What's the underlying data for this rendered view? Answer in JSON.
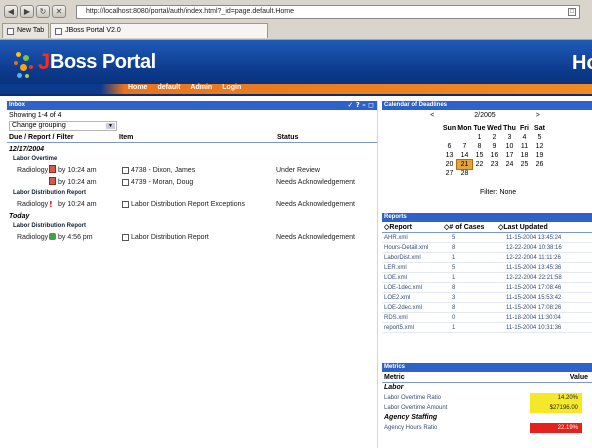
{
  "browser": {
    "url": "http://localhost:8080/portal/auth/index.html?_id=page.default.Home",
    "tabs": [
      {
        "label": "New Tab"
      },
      {
        "label": "JBoss Portal V2.0"
      }
    ]
  },
  "header": {
    "logo_j": "J",
    "logo_text": "Boss Portal",
    "right_text": "Ho",
    "menu": [
      "Home",
      "default",
      "Admin",
      "Login"
    ]
  },
  "inbox": {
    "title": "Inbox",
    "controls": "✓ ? – ◻",
    "showing": "Showing 1-4 of 4",
    "grouping": "Change grouping",
    "columns": [
      "Due / Report / Filter",
      "Item",
      "Status"
    ],
    "groups": [
      {
        "label": "Labor Overtime"
      },
      {
        "label": "Labor Distribution Report"
      },
      {
        "label": "Labor Distribution Report"
      }
    ],
    "dates": [
      "12/17/2004",
      "Today"
    ],
    "rows": [
      {
        "category": "Radiology",
        "due": "by 10:24 am",
        "item": "4738 - Dixon, James",
        "status": "Under Review"
      },
      {
        "category": "",
        "due": "by 10:24 am",
        "item": "4739 - Moran, Doug",
        "status": "Needs Acknowledgement"
      },
      {
        "category": "Radiology",
        "due": "by 10:24 am",
        "item": "Labor Distribution Report Exceptions",
        "status": "Needs Acknowledgement"
      },
      {
        "category": "Radiology",
        "due": "by 4:56 pm",
        "item": "Labor Distribution Report",
        "status": "Needs Acknowledgement"
      }
    ]
  },
  "calendar": {
    "title": "Calendar of Deadlines",
    "prev": "<",
    "month": "2/2005",
    "next": ">",
    "days": [
      "Sun",
      "Mon",
      "Tue",
      "Wed",
      "Thu",
      "Fri",
      "Sat"
    ],
    "weeks": [
      [
        "",
        "",
        "1",
        "2",
        "3",
        "4",
        "5"
      ],
      [
        "6",
        "7",
        "8",
        "9",
        "10",
        "11",
        "12"
      ],
      [
        "13",
        "14",
        "15",
        "16",
        "17",
        "18",
        "19"
      ],
      [
        "20",
        "21",
        "22",
        "23",
        "24",
        "25",
        "26"
      ],
      [
        "27",
        "28",
        "",
        "",
        "",
        "",
        ""
      ]
    ],
    "today": "21",
    "filter": "Filter: None"
  },
  "reports": {
    "title": "Reports",
    "columns": [
      "◇Report",
      "◇# of Cases",
      "◇Last Updated"
    ],
    "rows": [
      {
        "name": "AHR.xml",
        "cases": "5",
        "updated": "11-15-2004 13:45:24"
      },
      {
        "name": "Hours-Detail.xml",
        "cases": "8",
        "updated": "12-22-2004 10:38:16"
      },
      {
        "name": "LaborDist.xml",
        "cases": "1",
        "updated": "12-22-2004 11:11:26"
      },
      {
        "name": "LER.xml",
        "cases": "5",
        "updated": "11-15-2004 13:45:36"
      },
      {
        "name": "LOE.xml",
        "cases": "1",
        "updated": "12-22-2004 22:21:58"
      },
      {
        "name": "LOE-1dec.xml",
        "cases": "8",
        "updated": "11-15-2004 17:08:46"
      },
      {
        "name": "LOE2.xml",
        "cases": "3",
        "updated": "11-15-2004 15:53:42"
      },
      {
        "name": "LOE-2dec.xml",
        "cases": "8",
        "updated": "11-15-2004 17:08:26"
      },
      {
        "name": "RDS.xml",
        "cases": "0",
        "updated": "11-18-2004 11:30:04"
      },
      {
        "name": "report5.xml",
        "cases": "1",
        "updated": "11-15-2004 10:31:36"
      }
    ]
  },
  "metrics": {
    "title": "Metrics",
    "columns": [
      "Metric",
      "Value"
    ],
    "sections": [
      "Labor",
      "Agency Staffing"
    ],
    "rows": [
      {
        "label": "Labor Overtime Ratio",
        "value": "14.20%",
        "level": "yellow"
      },
      {
        "label": "Labor Overtime Amount",
        "value": "$27196.00",
        "level": "yellow"
      },
      {
        "label": "Agency Hours Ratio",
        "value": "22.19%",
        "level": "red"
      }
    ]
  },
  "colors": {
    "panel_title": "#2f62c9",
    "accent_orange": "#f08a24",
    "header_blue": "#0c3a8c",
    "metric_yellow": "#f5e82a",
    "metric_red": "#e3221c"
  }
}
